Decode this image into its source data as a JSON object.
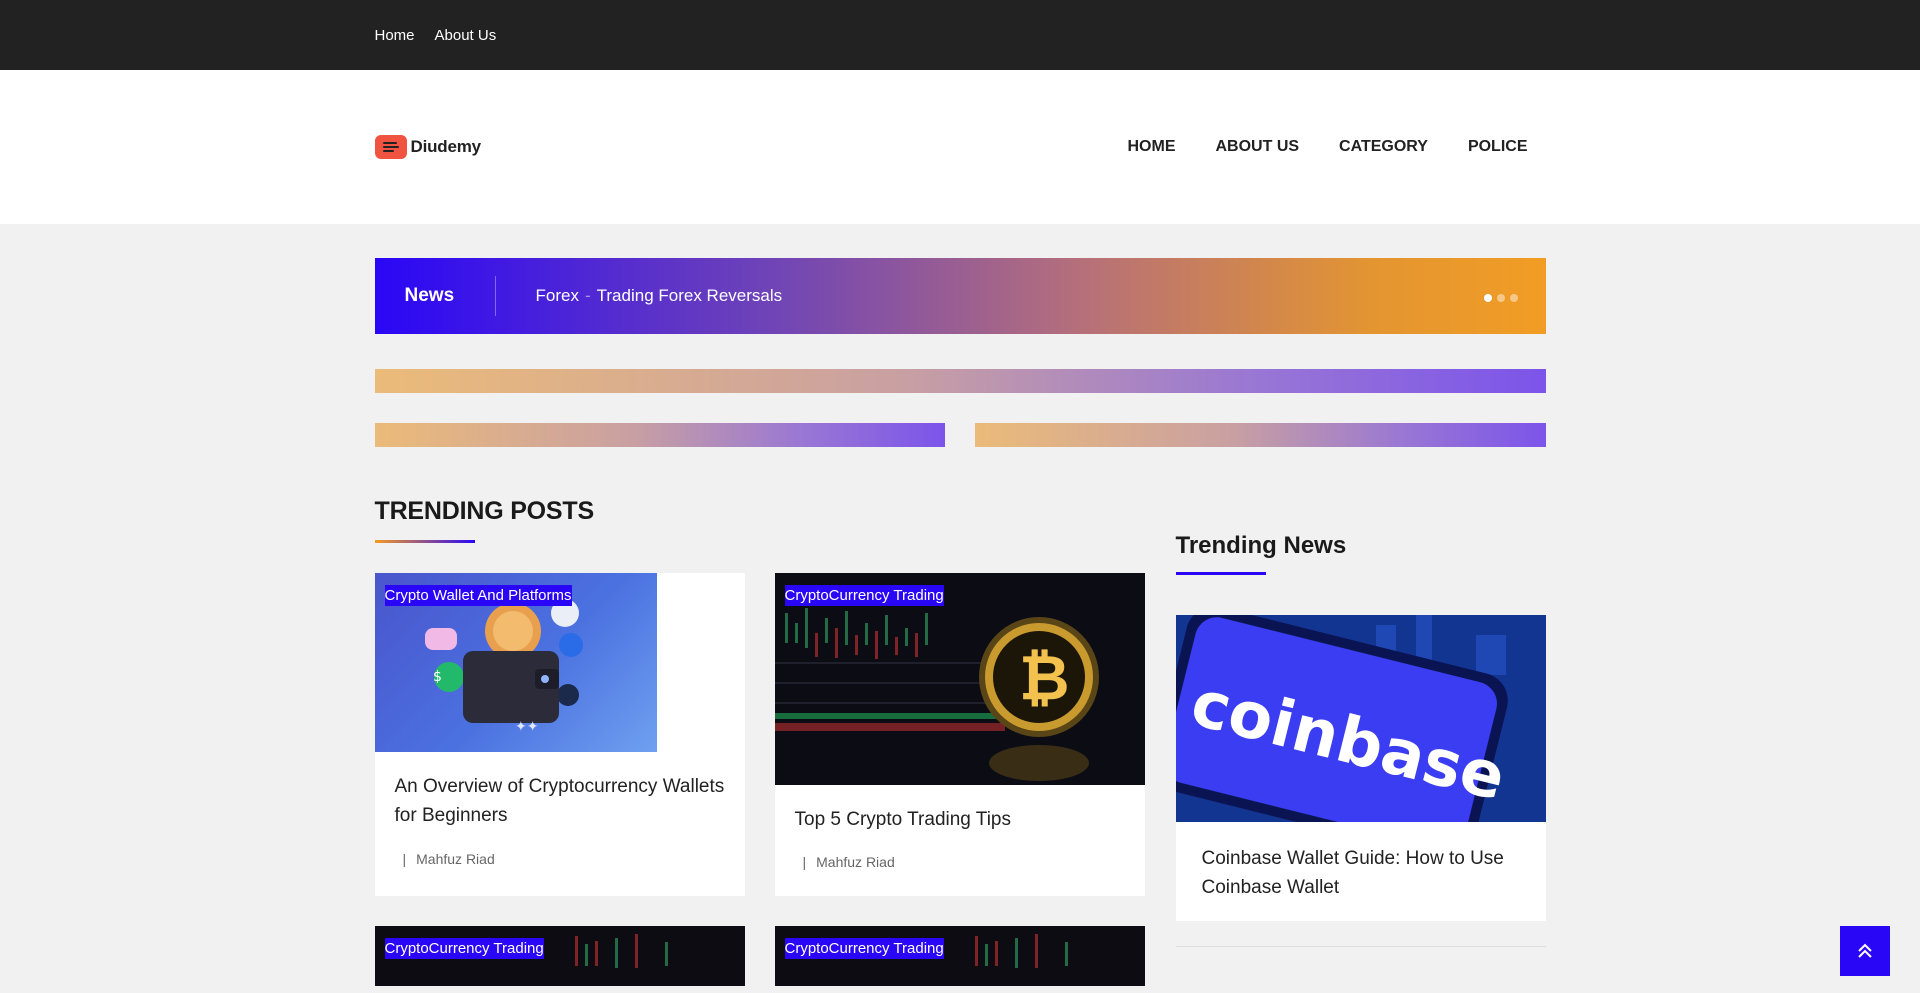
{
  "topbar": {
    "links": [
      "Home",
      "About Us"
    ]
  },
  "header": {
    "logo_text": "Diudemy",
    "nav": [
      "HOME",
      "ABOUT US",
      "CATEGORY",
      "POLICE"
    ]
  },
  "ticker": {
    "label": "News",
    "category": "Forex",
    "separator": "-",
    "headline": "Trading Forex Reversals",
    "slides": 3,
    "active_slide": 1
  },
  "trending_posts": {
    "title": "TRENDING POSTS",
    "cards": [
      {
        "category": "Crypto Wallet And Platforms",
        "title": "An Overview of Cryptocurrency Wallets for Beginners",
        "meta_sep": "|",
        "author": "Mahfuz Riad"
      },
      {
        "category": "CryptoCurrency Trading",
        "title": "Top 5 Crypto Trading Tips",
        "meta_sep": "|",
        "author": "Mahfuz Riad"
      }
    ],
    "next_cards": [
      {
        "category": "CryptoCurrency Trading"
      },
      {
        "category": "CryptoCurrency Trading"
      }
    ]
  },
  "trending_news": {
    "title": "Trending News",
    "card": {
      "image_text": "coinbase",
      "title": "Coinbase Wallet Guide: How to Use Coinbase Wallet"
    }
  },
  "colors": {
    "accent": "#2a06f7",
    "orange": "#f19d24",
    "topbar": "#222222"
  }
}
